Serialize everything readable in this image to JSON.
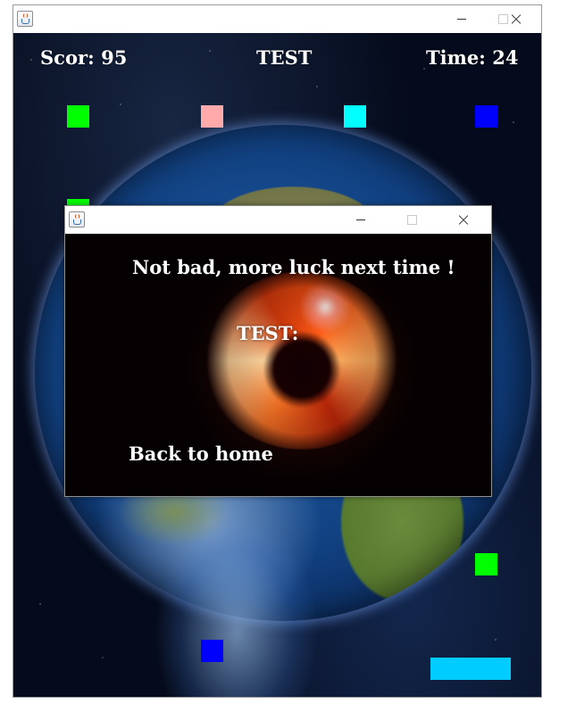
{
  "main_window": {
    "hud": {
      "score_text": "Scor: 95",
      "player_name": "TEST",
      "time_text": "Time: 24"
    },
    "blocks": [
      {
        "color": "#00ff00"
      },
      {
        "color": "#ffaaaa"
      },
      {
        "color": "#00ffff"
      },
      {
        "color": "#0000ff"
      },
      {
        "color": "#00ff00"
      },
      {
        "color": "#00ff00"
      },
      {
        "color": "#0000ff"
      }
    ],
    "paddle": {
      "color": "#00ccff"
    },
    "title_icon": "java-icon",
    "controls": [
      "minimize-icon",
      "maximize-icon",
      "close-icon"
    ]
  },
  "dialog": {
    "message": "Not bad, more luck next time !",
    "result_text": "TEST: ",
    "back_label": "Back to home",
    "title_icon": "java-icon",
    "controls": [
      "minimize-icon",
      "maximize-icon",
      "close-icon"
    ]
  }
}
